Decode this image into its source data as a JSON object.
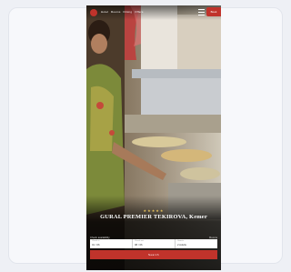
{
  "header": {
    "nav": [
      "Hotel",
      "Rooms",
      "Dining",
      "Offers"
    ],
    "book_label": "Book"
  },
  "hero": {
    "stars": "★★★★★",
    "title": "GURAL PREMIER TEKIROVA, Kemer"
  },
  "booking": {
    "caption": "Check availability",
    "caption_right": "Rooms",
    "fields": [
      {
        "label": "Check in",
        "value": "01 / 06"
      },
      {
        "label": "Check out",
        "value": "08 / 06"
      },
      {
        "label": "Guests",
        "value": "2 Adults"
      }
    ],
    "search_label": "Search"
  },
  "colors": {
    "accent": "#c0332b",
    "stars": "#e6c15a"
  }
}
